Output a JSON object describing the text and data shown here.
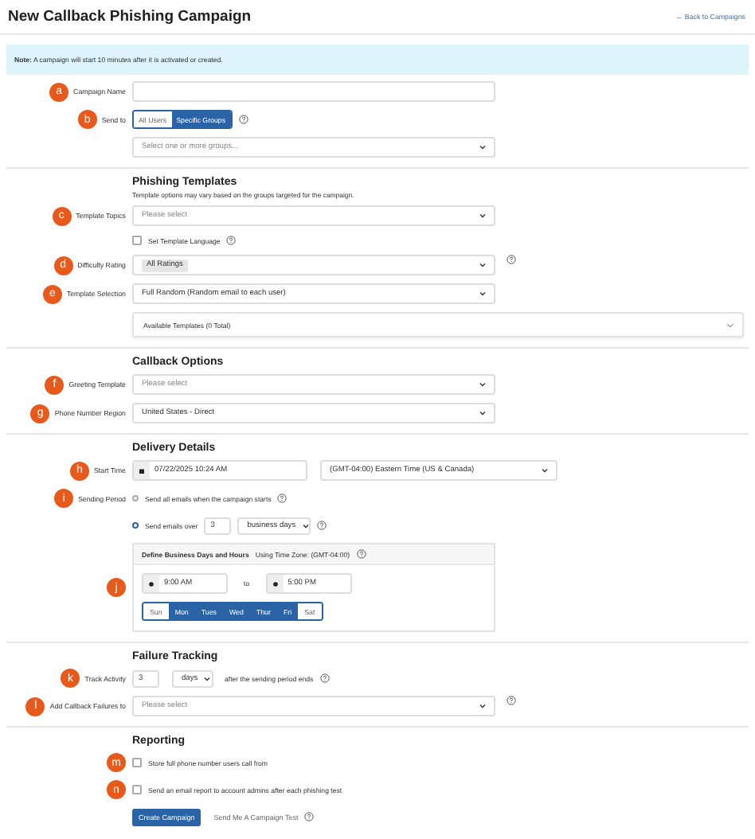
{
  "header": {
    "title": "New Callback Phishing Campaign",
    "back_link": "← Back to Campaigns"
  },
  "note": "**Note:** A campaign will start 10 minutes after it is activated or created.",
  "sections": [
    {
      "rows": [
        {
          "kind": "text",
          "badge": "a",
          "label": "Campaign Name"
        },
        {
          "kind": "segmented",
          "badge": "b",
          "label": "Send to",
          "help": true,
          "options": [
            {
              "label": "All Users",
              "selected": false
            },
            {
              "label": "Specific Groups",
              "selected": true
            }
          ]
        },
        {
          "kind": "select",
          "placeholder": "Select one or more groups..."
        }
      ]
    },
    {
      "heading": "Phishing Templates",
      "subtext": "Template options may vary based on the groups targeted for the campaign.",
      "rows": [
        {
          "kind": "select",
          "badge": "c",
          "label": "Template Topics",
          "placeholder": "Please select"
        },
        {
          "kind": "checkbox",
          "text": "Set Template Language",
          "checked": false,
          "help": true
        },
        {
          "kind": "select",
          "badge": "d",
          "label": "Difficulty Rating",
          "chip": "All Ratings",
          "help": true
        },
        {
          "kind": "select",
          "badge": "e",
          "label": "Template Selection",
          "value": "Full Random (Random email to each user)"
        },
        {
          "kind": "panel",
          "text": "Available Templates (0 Total)",
          "expanded": false
        }
      ]
    },
    {
      "heading": "Callback Options",
      "rows": [
        {
          "kind": "select",
          "badge": "f",
          "label": "Greeting Template",
          "placeholder": "Please select"
        },
        {
          "kind": "select",
          "badge": "g",
          "label": "Phone Number Region",
          "value": "United States - Direct"
        }
      ]
    },
    {
      "heading": "Delivery Details",
      "rows": [
        {
          "kind": "datetime",
          "badge": "h",
          "label": "Start Time",
          "value": "07/22/2025 10:24 AM",
          "timezone": "(GMT-04:00) Eastern Time (US & Canada)"
        },
        {
          "kind": "radio",
          "badge": "i",
          "label": "Sending Period",
          "text": "Send all emails when the campaign starts",
          "selected": false,
          "help": true
        },
        {
          "kind": "radio-count",
          "text": "Send emails over",
          "count": "3",
          "unit": "business days",
          "selected": true,
          "help": true
        },
        {
          "kind": "schedule",
          "badge": "j",
          "title": "Define Business Days and Hours",
          "zone": "Using Time Zone: (GMT-04:00)",
          "help": true,
          "start": "9:00 AM",
          "to": "to",
          "end": "5:00 PM",
          "days": [
            {
              "label": "Sun",
              "selected": false
            },
            {
              "label": "Mon",
              "selected": true
            },
            {
              "label": "Tues",
              "selected": true
            },
            {
              "label": "Wed",
              "selected": true
            },
            {
              "label": "Thur",
              "selected": true
            },
            {
              "label": "Fri",
              "selected": true
            },
            {
              "label": "Sat",
              "selected": false
            }
          ]
        }
      ]
    },
    {
      "heading": "Failure Tracking",
      "rows": [
        {
          "kind": "track",
          "badge": "k",
          "label": "Track Activity",
          "count": "3",
          "unit": "days",
          "after": "after the sending period ends",
          "help": true
        },
        {
          "kind": "select",
          "badge": "l",
          "label": "Add Callback Failures to",
          "placeholder": "Please select",
          "help": true
        }
      ]
    },
    {
      "heading": "Reporting",
      "rows": [
        {
          "kind": "checkbox",
          "badge": "m",
          "text": "Store full phone number users call from",
          "checked": false
        },
        {
          "kind": "checkbox",
          "badge": "n",
          "text": "Send an email report to account admins after each phishing test",
          "checked": false
        },
        {
          "kind": "buttons",
          "primary": "Create Campaign",
          "secondary": "Send Me A Campaign Test",
          "help": true
        }
      ]
    }
  ]
}
